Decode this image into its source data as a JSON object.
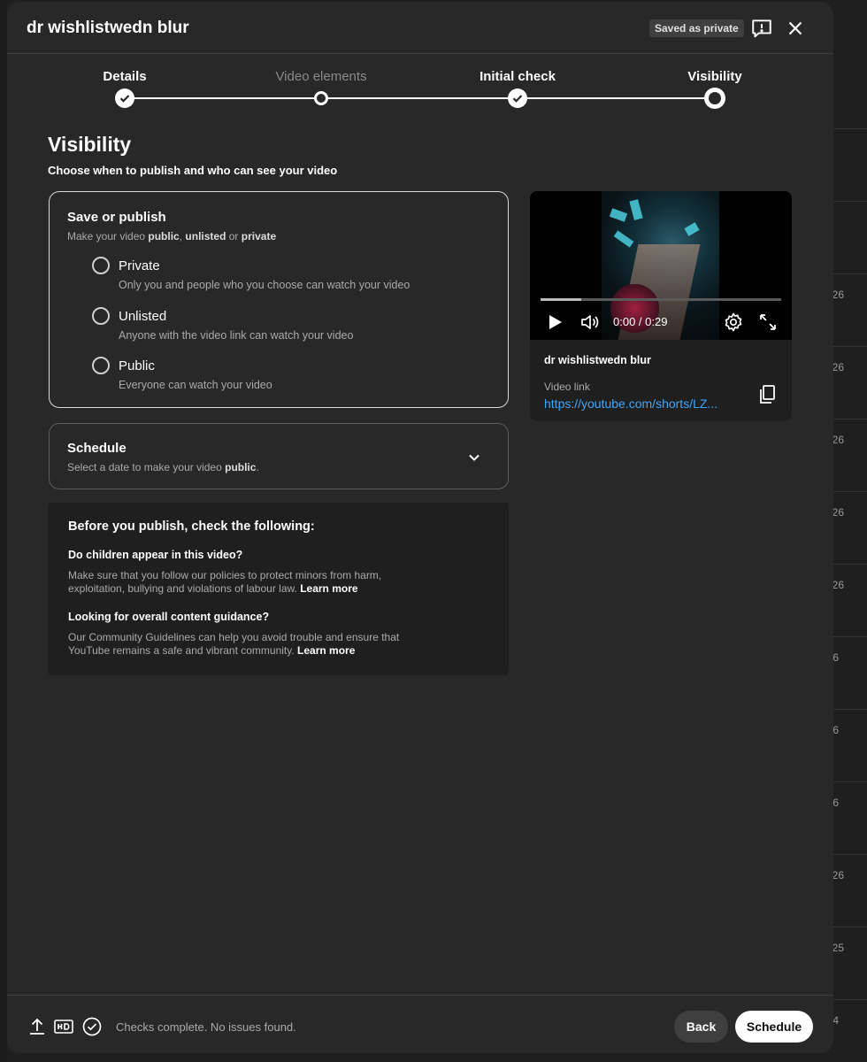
{
  "header": {
    "title": "dr wishlistwedn blur",
    "saved_badge": "Saved as private"
  },
  "stepper": {
    "steps": [
      {
        "label": "Details",
        "state": "done"
      },
      {
        "label": "Video elements",
        "state": "skipped"
      },
      {
        "label": "Initial check",
        "state": "done"
      },
      {
        "label": "Visibility",
        "state": "current"
      }
    ]
  },
  "visibility": {
    "title": "Visibility",
    "subtitle": "Choose when to publish and who can see your video",
    "save_publish": {
      "title": "Save or publish",
      "sub_prefix": "Make your video ",
      "sub_public": "public",
      "sub_sep1": ", ",
      "sub_unlisted": "unlisted",
      "sub_sep2": " or ",
      "sub_private": "private",
      "options": [
        {
          "label": "Private",
          "desc": "Only you and people who you choose can watch your video",
          "selected": false
        },
        {
          "label": "Unlisted",
          "desc": "Anyone with the video link can watch your video",
          "selected": false
        },
        {
          "label": "Public",
          "desc": "Everyone can watch your video",
          "selected": false
        }
      ]
    },
    "schedule": {
      "title": "Schedule",
      "sub_prefix": "Select a date to make your video ",
      "sub_bold": "public",
      "sub_suffix": "."
    },
    "checklist": {
      "title": "Before you publish, check the following:",
      "items": [
        {
          "question": "Do children appear in this video?",
          "text": "Make sure that you follow our policies to protect minors from harm, exploitation, bullying and violations of labour law.",
          "link": "Learn more"
        },
        {
          "question": "Looking for overall content guidance?",
          "text": "Our Community Guidelines can help you avoid trouble and ensure that YouTube remains a safe and vibrant community.",
          "link": "Learn more"
        }
      ]
    }
  },
  "preview": {
    "time": "0:00 / 0:29",
    "progress": 0.17,
    "title": "dr wishlistwedn blur",
    "link_label": "Video link",
    "link": "https://youtube.com/shorts/LZ..."
  },
  "footer": {
    "status": "Checks complete. No issues found.",
    "back_label": "Back",
    "schedule_label": "Schedule"
  },
  "background": {
    "numbers": [
      "26",
      "26",
      "26",
      "26",
      "26",
      "6",
      "6",
      "6",
      "26",
      "25",
      "4"
    ]
  },
  "colors": {
    "dialog_bg": "#282828",
    "link": "#3ea6ff",
    "primary_button": "#ffffff"
  }
}
